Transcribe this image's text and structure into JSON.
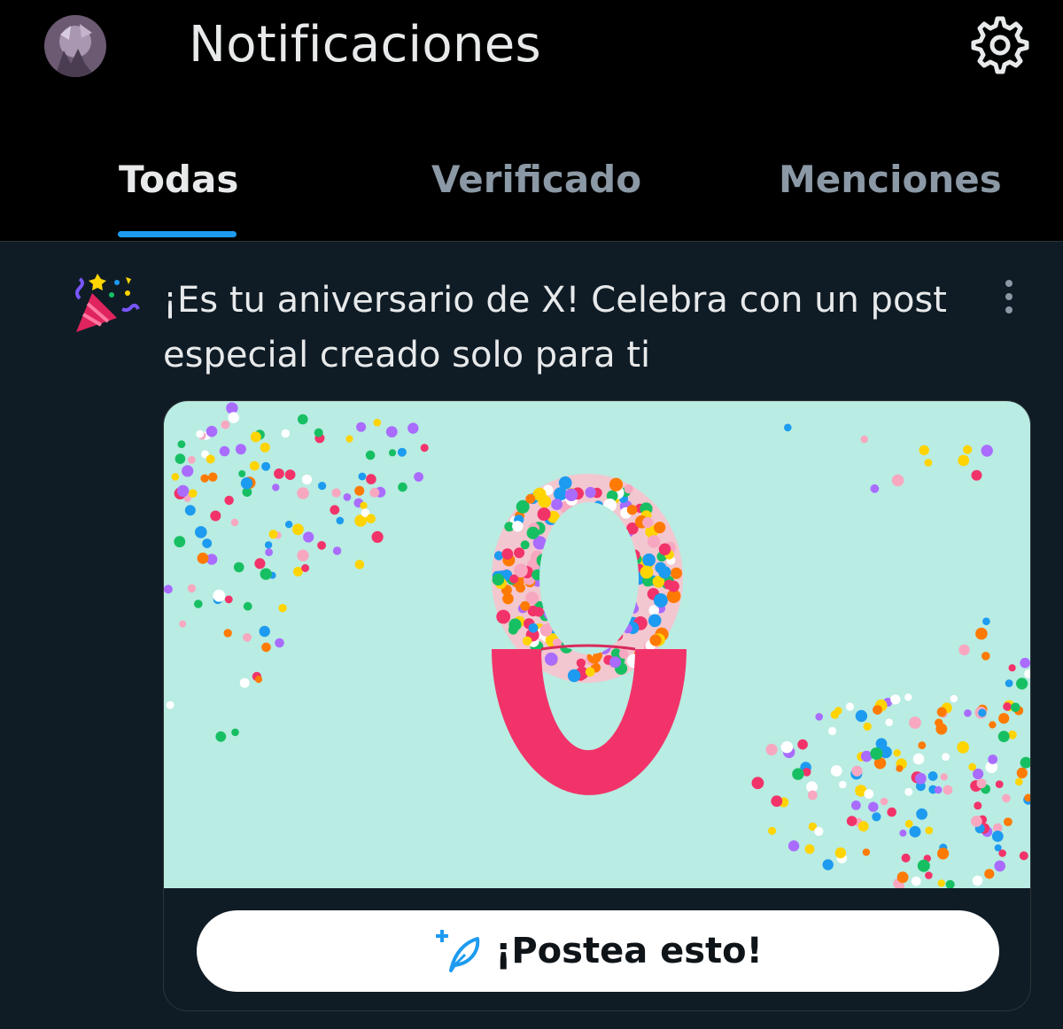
{
  "header": {
    "title": "Notificaciones"
  },
  "tabs": [
    {
      "label": "Todas",
      "active": true
    },
    {
      "label": "Verificado",
      "active": false
    },
    {
      "label": "Menciones",
      "active": false
    }
  ],
  "notification": {
    "icon": "party-popper-icon",
    "line1": "¡Es tu aniversario de X! Celebra con un post",
    "line2": "especial creado solo para ti",
    "image_number": "8",
    "button_label": "¡Postea esto!"
  },
  "colors": {
    "accent": "#1d9bf0",
    "background": "#0f1c26",
    "image_background": "#b9ece2",
    "eight_top": "#f2c7d0",
    "eight_bottom": "#f2336a"
  }
}
